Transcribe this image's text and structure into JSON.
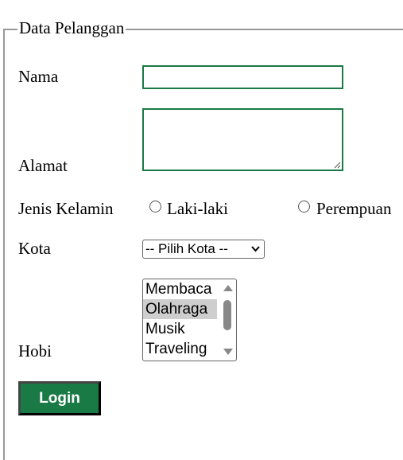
{
  "form": {
    "legend": "Data Pelanggan",
    "nama": {
      "label": "Nama",
      "value": ""
    },
    "alamat": {
      "label": "Alamat",
      "value": ""
    },
    "jenis_kelamin": {
      "label": "Jenis Kelamin",
      "options": [
        "Laki-laki",
        "Perempuan"
      ],
      "selected": null
    },
    "kota": {
      "label": "Kota",
      "selected": "-- Pilih Kota --"
    },
    "hobi": {
      "label": "Hobi",
      "options": [
        "Membaca",
        "Olahraga",
        "Musik",
        "Traveling"
      ],
      "selected": "Olahraga"
    },
    "submit_label": "Login"
  },
  "colors": {
    "accent": "#1a7a45"
  }
}
